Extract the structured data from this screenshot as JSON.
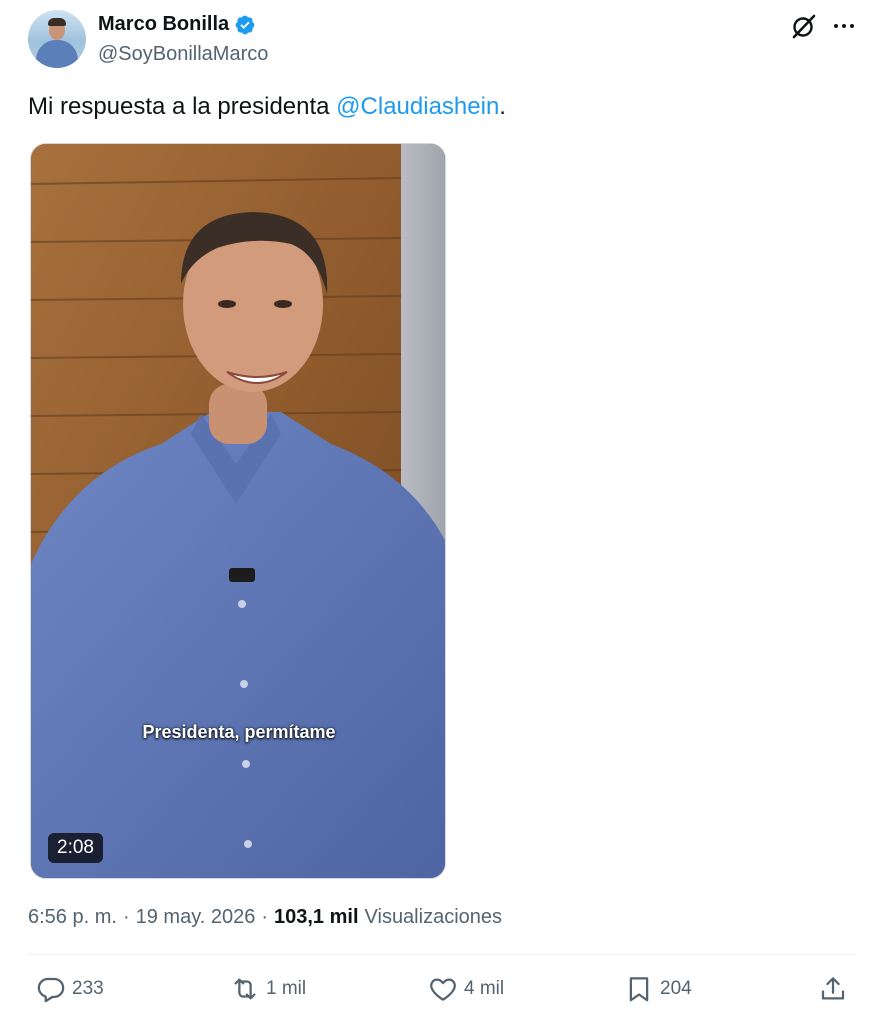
{
  "author": {
    "name": "Marco Bonilla",
    "handle": "@SoyBonillaMarco",
    "verified": true
  },
  "tweet": {
    "text_before": "Mi respuesta a la presidenta ",
    "mention": "@Claudiashein",
    "text_after": "."
  },
  "media": {
    "caption": "Presidenta, permítame",
    "duration": "2:08"
  },
  "meta": {
    "time": "6:56 p. m.",
    "separator": "·",
    "date": "19 may. 2026",
    "views_count": "103,1 mil",
    "views_label": "Visualizaciones"
  },
  "actions": {
    "replies": "233",
    "reposts": "1 mil",
    "likes": "4 mil",
    "bookmarks": "204"
  },
  "colors": {
    "accent": "#1d9bf0",
    "text_primary": "#0f1419",
    "text_secondary": "#536471"
  }
}
